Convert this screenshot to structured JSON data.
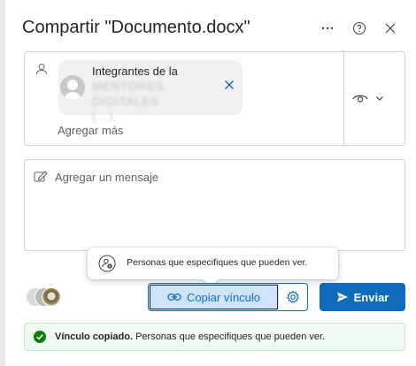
{
  "dialog": {
    "title": "Compartir \"Documento.docx\"",
    "more_icon": "more-horizontal-icon",
    "help_icon": "help-icon",
    "close_icon": "close-icon"
  },
  "recipients": {
    "chip": {
      "line1": "Integrantes de la",
      "line2": "MENTORES DIGITALES",
      "line3": "(...)"
    },
    "add_more_placeholder": "Agregar más",
    "permission_icon": "eye-icon"
  },
  "message": {
    "placeholder": "Agregar un mensaje"
  },
  "tooltip": {
    "text": "Personas que especifiques que pueden ver."
  },
  "actions": {
    "copy_link_label": "Copiar vínculo",
    "send_label": "Enviar"
  },
  "toast": {
    "bold": "Vínculo copiado.",
    "text": " Personas que especifiques que pueden ver."
  },
  "colors": {
    "accent": "#0f6cbd",
    "success": "#107c10",
    "toast_bg": "#f1faf1"
  }
}
